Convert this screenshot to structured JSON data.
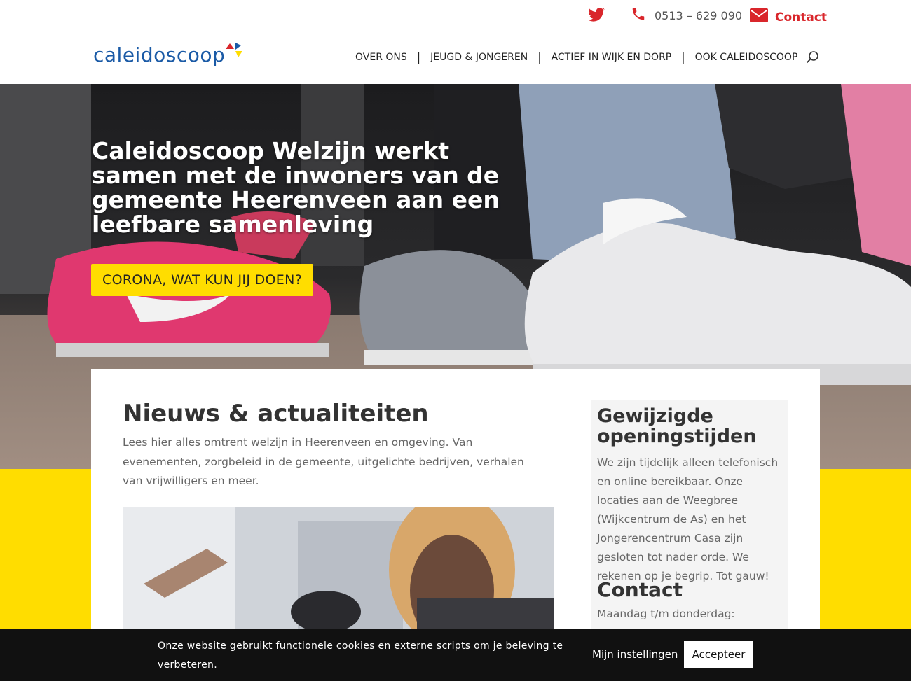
{
  "topbar": {
    "twitter_icon": "twitter-icon",
    "phone_icon": "phone-icon",
    "phone": "0513 – 629 090",
    "mail_icon": "mail-icon",
    "contact_label": "Contact",
    "accent": "#d9262b"
  },
  "header": {
    "logo": "caleidoscoop",
    "nav": [
      {
        "label": "OVER ONS"
      },
      {
        "label": "JEUGD & JONGEREN"
      },
      {
        "label": "ACTIEF IN WIJK EN DORP"
      },
      {
        "label": "OOK CALEIDOSCOOP"
      }
    ],
    "search_icon": "search-icon"
  },
  "hero": {
    "title": "Caleidoscoop Welzijn werkt samen met de inwoners van de gemeente Heerenveen aan een leefbare samenleving",
    "button": "CORONA, WAT KUN JIJ DOEN?",
    "button_color": "#ffdd00"
  },
  "news": {
    "title": "Nieuws & actualiteiten",
    "description": "Lees hier alles omtrent welzijn in Heerenveen en omgeving. Van evenementen, zorgbeleid in de gemeente, uitgelichte bedrijven, verhalen van vrijwilligers en meer."
  },
  "sidebar": {
    "title": "Gewijzigde openingstijden",
    "text": "We zijn tijdelijk alleen telefonisch en online bereikbaar. Onze locaties aan de Weegbree (Wijkcentrum de As) en het Jongerencentrum Casa zijn gesloten tot nader orde. We rekenen op je begrip. Tot gauw!",
    "contact_title": "Contact",
    "hours": "Maandag t/m donderdag:"
  },
  "cookie": {
    "text": "Onze website gebruikt functionele cookies en externe scripts om je beleving te verbeteren.",
    "settings": "Mijn instellingen",
    "accept": "Accepteer"
  }
}
